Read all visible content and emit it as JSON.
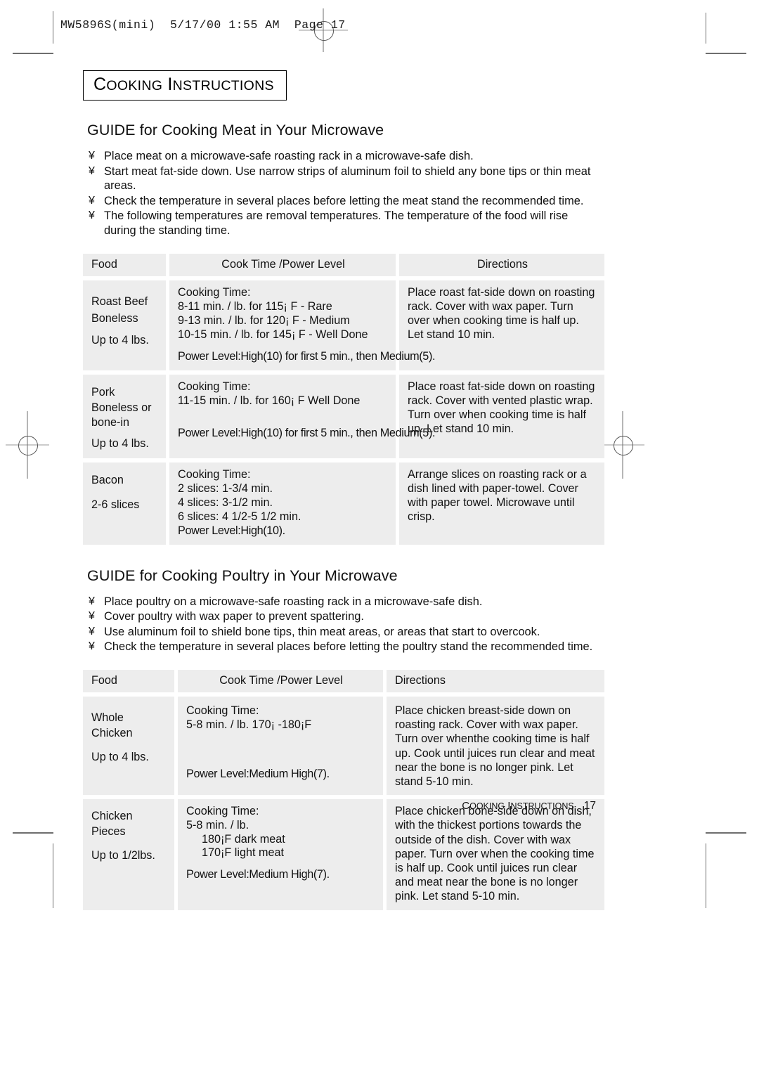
{
  "printer": {
    "slug": "MW5896S(mini)  5/17/00 1:55 AM  Page 17"
  },
  "chapter": {
    "word1_cap": "C",
    "word1_rest": "OOKING",
    "word2_cap": "I",
    "word2_rest": "NSTRUCTIONS"
  },
  "sections": [
    {
      "heading": "GUIDE for Cooking Meat in Your Microwave",
      "bullet_glyph": "¥",
      "bullets": [
        "Place meat on a microwave-safe roasting rack in a microwave-safe dish.",
        "Start meat fat-side down. Use narrow strips of aluminum foil to shield any bone tips or thin meat areas.",
        "Check the temperature in several places before letting the meat stand the recommended time.",
        "The following temperatures are removal temperatures. The temperature of the food will rise during the standing time."
      ],
      "table": {
        "headers": [
          "Food",
          "Cook Time /Power Level",
          "Directions"
        ],
        "rows": [
          {
            "food": [
              "Roast Beef",
              "Boneless",
              "Up to 4 lbs."
            ],
            "cook_title": "Cooking Time:",
            "cook_lines": [
              "8-11 min. / lb. for 115¡ F - Rare",
              "9-13 min. / lb. for 120¡ F - Medium",
              "10-15 min. / lb. for 145¡ F - Well Done"
            ],
            "power": "Power Level:High(10) for first 5 min., then Medium(5).",
            "directions": "Place roast fat-side down on roasting rack. Cover with wax paper. Turn over when cooking time is half up. Let stand 10 min."
          },
          {
            "food": [
              "Pork",
              "Boneless or",
              "bone-in",
              "Up to 4 lbs."
            ],
            "cook_title": "Cooking Time:",
            "cook_lines": [
              "11-15 min. / lb. for 160¡ F Well Done"
            ],
            "power": "Power Level:High(10) for first 5 min., then Medium(5).",
            "directions": "Place roast fat-side down on roasting rack. Cover with vented plastic wrap. Turn over when cooking time is half up. Let stand 10 min."
          },
          {
            "food": [
              "Bacon",
              "2-6 slices"
            ],
            "cook_title": "Cooking Time:",
            "cook_lines": [
              "2 slices: 1-3/4 min.",
              "4 slices: 3-1/2 min.",
              "6 slices: 4 1/2-5 1/2 min."
            ],
            "power": "Power Level:High(10).",
            "directions": "Arrange slices on roasting rack or a dish lined with paper-towel. Cover with paper towel. Microwave until crisp."
          }
        ]
      }
    },
    {
      "heading": "GUIDE for Cooking Poultry in Your Microwave",
      "bullet_glyph": "¥",
      "bullets": [
        "Place poultry on a microwave-safe roasting rack in a microwave-safe dish.",
        "Cover poultry with wax paper to prevent spattering.",
        "Use aluminum foil to shield bone tips, thin meat areas, or areas that start to overcook.",
        "Check the temperature in several places before letting the poultry stand the recommended time."
      ],
      "table": {
        "headers": [
          "Food",
          "Cook Time /Power Level",
          "Directions"
        ],
        "rows": [
          {
            "food": [
              "Whole",
              "Chicken",
              "Up to 4 lbs."
            ],
            "cook_title": "Cooking Time:",
            "cook_lines": [
              "5-8 min. / lb.  170¡ -180¡F"
            ],
            "power": "Power Level:Medium High(7).",
            "directions": "Place chicken breast-side down on roasting rack. Cover with wax paper. Turn over whenthe cooking time is half up. Cook until juices run clear and meat near the bone is no longer pink. Let stand 5-10 min."
          },
          {
            "food": [
              "Chicken",
              "Pieces",
              "Up to 1/2lbs."
            ],
            "cook_title": "Cooking Time:",
            "cook_lines": [
              "5-8 min. / lb.",
              "180¡F  dark meat",
              "170¡F  light meat"
            ],
            "power": "Power Level:Medium High(7).",
            "directions": "Place chicken bone-side down on dish, with the thickest portions towards the outside of the dish. Cover with wax paper. Turn over when the cooking time is half up. Cook until juices run clear and meat near the bone is no longer pink. Let stand 5-10 min."
          }
        ]
      }
    }
  ],
  "footer": {
    "word1_cap": "C",
    "word1_rest": "OOKING",
    "word2_cap": "I",
    "word2_rest": "NSTRUCTIONS",
    "page_number": "17"
  }
}
